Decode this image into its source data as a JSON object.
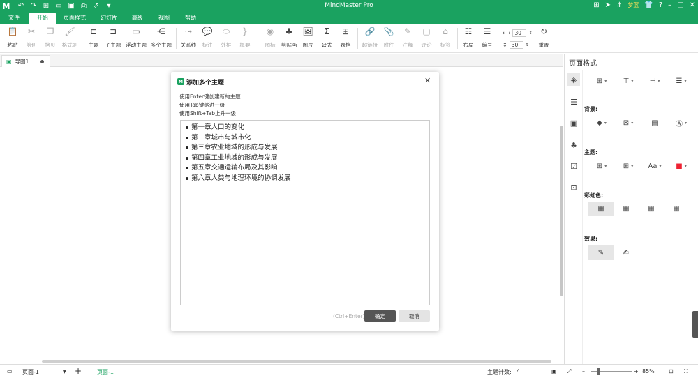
{
  "titlebar": {
    "app_title": "MindMaster Pro",
    "user": "梦蓝"
  },
  "menu": {
    "tabs": [
      "文件",
      "开始",
      "页面样式",
      "幻灯片",
      "高级",
      "视图",
      "帮助"
    ],
    "active": "开始"
  },
  "ribbon": {
    "paste": "粘贴",
    "cut": "剪切",
    "copy": "拷贝",
    "format_painter": "格式刷",
    "topic": "主题",
    "subtopic": "子主题",
    "floating_topic": "浮动主题",
    "multiple_topics": "多个主题",
    "relationship": "关系线",
    "callout": "标注",
    "boundary": "外框",
    "summary": "概要",
    "icon": "图标",
    "clipart": "剪贴画",
    "image": "图片",
    "formula": "公式",
    "table": "表格",
    "hyperlink": "超链接",
    "attachment": "附件",
    "note": "注释",
    "comment": "评论",
    "tag": "标签",
    "layout": "布局",
    "numbering": "编号",
    "spacing_h": "30",
    "spacing_v": "30",
    "reset": "重置"
  },
  "doctab": {
    "label": "导图1"
  },
  "dialog": {
    "title": "添加多个主题",
    "hints": [
      "使用Enter键创建新的主题",
      "使用Tab键缩进一级",
      "使用Shift+Tab上升一级"
    ],
    "topics": [
      "第一章人口的变化",
      "第二章城市与城市化",
      "第三章农业地域的形成与发展",
      "第四章工业地域的形成与发展",
      "第五章交通运输布局及其影响",
      "第六章人类与地理环境的协调发展"
    ],
    "shortcut": "(Ctrl+Enter)",
    "ok": "确定",
    "cancel": "取消"
  },
  "panel": {
    "title": "页面格式",
    "background": "背景:",
    "theme": "主题:",
    "rainbow": "彩虹色:",
    "effect": "效果:"
  },
  "status": {
    "page_select": "页面-1",
    "page_tab": "页面-1",
    "topic_count_label": "主题计数:",
    "topic_count": "4",
    "zoom": "85%"
  }
}
